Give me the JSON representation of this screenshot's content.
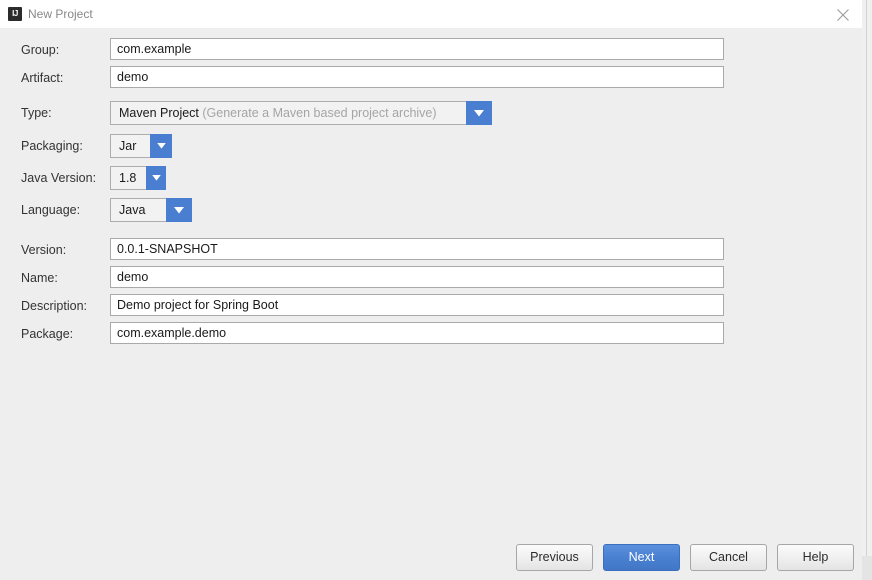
{
  "window": {
    "title": "New Project",
    "app_icon_text": "IJ",
    "close_icon": "close-icon"
  },
  "form": {
    "fields": [
      {
        "label": "Group:",
        "value": "com.example"
      },
      {
        "label": "Artifact:",
        "value": "demo"
      },
      {
        "label": "Version:",
        "value": "0.0.1-SNAPSHOT"
      },
      {
        "label": "Name:",
        "value": "demo"
      },
      {
        "label": "Description:",
        "value": "Demo project for Spring Boot"
      },
      {
        "label": "Package:",
        "value": "com.example.demo"
      }
    ],
    "combos": {
      "type": {
        "label": "Type:",
        "value": "Maven Project",
        "hint": "(Generate a Maven based project archive)"
      },
      "packaging": {
        "label": "Packaging:",
        "value": "Jar"
      },
      "java_version": {
        "label": "Java Version:",
        "value": "1.8"
      },
      "language": {
        "label": "Language:",
        "value": "Java"
      }
    }
  },
  "buttons": {
    "previous": "Previous",
    "next": "Next",
    "cancel": "Cancel",
    "help": "Help"
  },
  "colors": {
    "accent_blue": "#4a7ed0",
    "default_button_blue": "#4a80d0",
    "dialog_background": "#eeeeee",
    "titlebar_background": "#ffffff"
  }
}
